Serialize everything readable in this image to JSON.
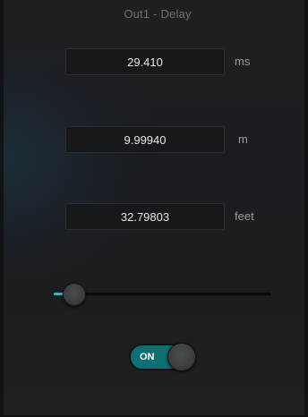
{
  "window": {
    "title": "Out1 - Delay"
  },
  "delay": {
    "ms": {
      "value": "29.410",
      "unit": "ms"
    },
    "meters": {
      "value": "9.99940",
      "unit": "m"
    },
    "feet": {
      "value": "32.79803",
      "unit": "feet"
    }
  },
  "slider": {
    "value_fraction": 0.06,
    "accent_color": "#1cc6c6"
  },
  "toggle": {
    "label": "ON",
    "state": "on",
    "color": "#0f6f71"
  }
}
